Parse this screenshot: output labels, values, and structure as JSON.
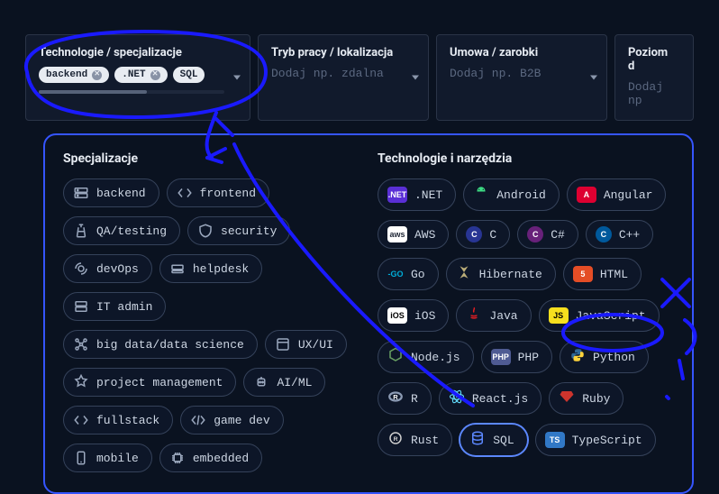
{
  "filters": [
    {
      "label": "Technologie / specjalizacje",
      "placeholder": "",
      "chips": [
        "backend",
        ".NET",
        "SQL"
      ]
    },
    {
      "label": "Tryb pracy / lokalizacja",
      "placeholder": "Dodaj np. zdalna",
      "chips": []
    },
    {
      "label": "Umowa / zarobki",
      "placeholder": "Dodaj np. B2B",
      "chips": []
    },
    {
      "label": "Poziom d",
      "placeholder": "Dodaj np",
      "chips": []
    }
  ],
  "panel": {
    "left_title": "Specjalizacje",
    "right_title": "Technologie i narzędzia",
    "specializations": [
      [
        "backend",
        "frontend"
      ],
      [
        "QA/testing",
        "security"
      ],
      [
        "devOps",
        "helpdesk"
      ],
      [
        "IT admin"
      ],
      [
        "big data/data science",
        "UX/UI"
      ],
      [
        "project management",
        "AI/ML"
      ],
      [
        "fullstack",
        "game dev"
      ],
      [
        "mobile",
        "embedded"
      ]
    ],
    "technologies": [
      [
        ".NET",
        "Android",
        "Angular"
      ],
      [
        "AWS",
        "C",
        "C#",
        "C++"
      ],
      [
        "Go",
        "Hibernate",
        "HTML"
      ],
      [
        "iOS",
        "Java",
        "JavaScript"
      ],
      [
        "Node.js",
        "PHP",
        "Python"
      ],
      [
        "R",
        "React.js",
        "Ruby"
      ],
      [
        "Rust",
        "SQL",
        "TypeScript"
      ]
    ],
    "selected_tech": [
      "SQL"
    ]
  },
  "tech_styles": {
    ".NET": {
      "kind": "badge",
      "bg": "#5a2fd6",
      "txt": ".NET"
    },
    "Android": {
      "kind": "svg",
      "fill": "#3ddc84"
    },
    "Angular": {
      "kind": "badge",
      "bg": "#dd0031",
      "txt": "A"
    },
    "AWS": {
      "kind": "badge",
      "bg": "#ffffff",
      "fg": "#1c2434",
      "txt": "aws"
    },
    "C": {
      "kind": "badge",
      "bg": "#283593",
      "txt": "C",
      "round": true
    },
    "C#": {
      "kind": "badge",
      "bg": "#68217a",
      "txt": "C",
      "round": true
    },
    "C++": {
      "kind": "badge",
      "bg": "#00599c",
      "txt": "C",
      "round": true
    },
    "Go": {
      "kind": "text",
      "color": "#00ADD8",
      "txt": "-GO"
    },
    "Hibernate": {
      "kind": "svg",
      "fill": "#bcae79"
    },
    "HTML": {
      "kind": "badge",
      "bg": "#e44d26",
      "txt": "5"
    },
    "iOS": {
      "kind": "badge",
      "bg": "#ffffff",
      "fg": "#000",
      "txt": "iOS"
    },
    "Java": {
      "kind": "svg",
      "fill": "#e11e22"
    },
    "JavaScript": {
      "kind": "badge",
      "bg": "#f7df1e",
      "fg": "#000",
      "txt": "JS"
    },
    "Node.js": {
      "kind": "svg",
      "fill": "#68a063"
    },
    "PHP": {
      "kind": "badge",
      "bg": "#4f5b93",
      "txt": "PHP"
    },
    "Python": {
      "kind": "svg",
      "fill": "#ffd43b"
    },
    "R": {
      "kind": "svg",
      "fill": "#8c9bb4"
    },
    "React.js": {
      "kind": "svg",
      "fill": "#61dafb"
    },
    "Ruby": {
      "kind": "svg",
      "fill": "#cc342d"
    },
    "Rust": {
      "kind": "svg",
      "fill": "#cfcfcf"
    },
    "SQL": {
      "kind": "svg",
      "fill": "#5c88ff"
    },
    "TypeScript": {
      "kind": "badge",
      "bg": "#3178c6",
      "txt": "TS"
    }
  }
}
